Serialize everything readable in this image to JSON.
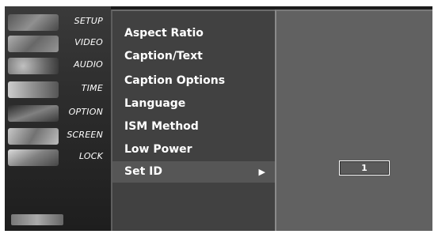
{
  "tabs": [
    {
      "label": "SETUP",
      "thumb_color": "#8a8a8a"
    },
    {
      "label": "VIDEO",
      "thumb_color": "#a5a5a5"
    },
    {
      "label": "AUDIO",
      "thumb_color": "#9c9c9c"
    },
    {
      "label": "TIME",
      "thumb_color": "#b5b5b5"
    },
    {
      "label": "OPTION",
      "thumb_color": "#6e6e6e"
    },
    {
      "label": "SCREEN",
      "thumb_color": "#b0b0b0"
    },
    {
      "label": "LOCK",
      "thumb_color": "#c4c4c4"
    }
  ],
  "menu": {
    "items": [
      {
        "label": "Aspect Ratio"
      },
      {
        "label": "Caption/Text"
      },
      {
        "label": "Caption Options"
      },
      {
        "label": "Language"
      },
      {
        "label": "ISM Method"
      },
      {
        "label": "Low Power"
      },
      {
        "label": "Set ID",
        "arrow": "▶",
        "selected": true
      }
    ]
  },
  "panel": {
    "set_id_value": "1"
  }
}
